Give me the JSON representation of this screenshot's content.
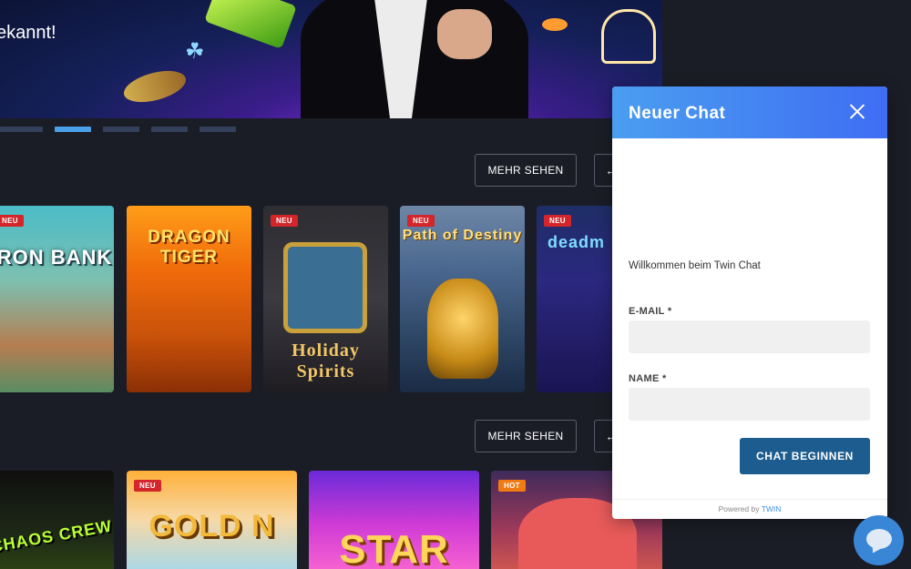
{
  "hero": {
    "text": "ekannt!"
  },
  "carousel": {
    "slides": 5,
    "active_index": 1
  },
  "section1": {
    "more_label": "MEHR SEHEN",
    "arrow": "←"
  },
  "section2": {
    "more_label": "MEHR SEHEN",
    "arrow": "←"
  },
  "games_row1": [
    {
      "title": "IRON BANK",
      "badge": "NEU"
    },
    {
      "title": "DRAGON TIGER",
      "badge": ""
    },
    {
      "title": "Holiday Spirits",
      "badge": "NEU"
    },
    {
      "title": "Path of Destiny",
      "badge": "NEU"
    },
    {
      "title": "deadm",
      "badge": "NEU"
    }
  ],
  "games_row2": [
    {
      "title": "CHAOS CREW",
      "badge": ""
    },
    {
      "title": "GOLD N",
      "badge": "NEU"
    },
    {
      "title": "STAR",
      "badge": ""
    },
    {
      "title": "",
      "badge": "HOT"
    }
  ],
  "chat": {
    "title": "Neuer Chat",
    "welcome": "Willkommen beim Twin Chat",
    "email_label": "E-MAIL *",
    "name_label": "NAME *",
    "start_label": "CHAT BEGINNEN",
    "footer_prefix": "Powered by",
    "footer_brand": "TWIN"
  },
  "colors": {
    "chat_button": "#1d5c8e",
    "chat_header": "#3f6df3",
    "launcher": "#3a86d6"
  },
  "icons": {
    "close": "close-icon",
    "launcher": "chat-bubble-icon"
  }
}
